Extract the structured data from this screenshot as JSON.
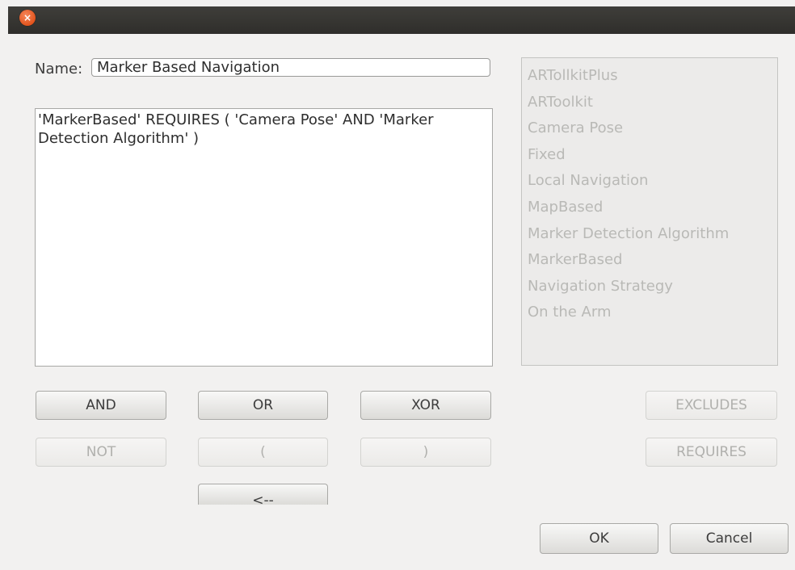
{
  "window": {
    "close_glyph": "×"
  },
  "form": {
    "name_label": "Name:",
    "name_value": "Marker Based Navigation",
    "expression": "'MarkerBased' REQUIRES ( 'Camera Pose' AND 'Marker Detection Algorithm' )"
  },
  "features": [
    "ARTollkitPlus",
    "ARToolkit",
    "Camera Pose",
    "Fixed",
    "Local Navigation",
    "MapBased",
    "Marker Detection Algorithm",
    "MarkerBased",
    "Navigation Strategy",
    "On the Arm"
  ],
  "operators": {
    "and": "AND",
    "or": "OR",
    "xor": "XOR",
    "not": "NOT",
    "lparen": "(",
    "rparen": ")",
    "back": "<--"
  },
  "relations": {
    "excludes": "EXCLUDES",
    "requires": "REQUIRES"
  },
  "dialog": {
    "ok": "OK",
    "cancel": "Cancel"
  }
}
